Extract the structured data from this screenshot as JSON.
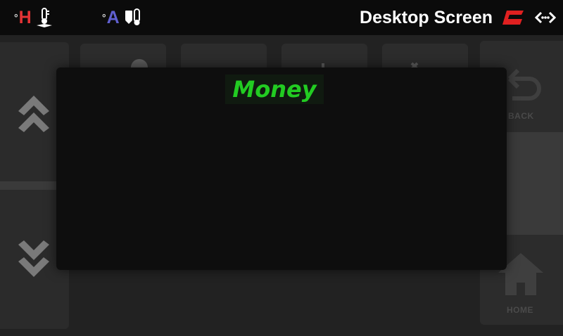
{
  "topbar": {
    "hot_temp": {
      "degree": "°",
      "letter": "H",
      "icon": "hotend-thermometer-icon"
    },
    "ambient_temp": {
      "degree": "°",
      "letter": "A",
      "icon": "ambient-thermometer-icon"
    },
    "screen_title": "Desktop Screen",
    "brand_icon": "brand-logo-icon",
    "connection_icon": "connection-arrows-icon"
  },
  "sidebar_left": {
    "scroll_up_icon": "double-chevron-up-icon",
    "scroll_down_icon": "double-chevron-down-icon"
  },
  "sidebar_right": {
    "back_label": "BACK",
    "home_label": "HOME"
  },
  "popup": {
    "title": "Money"
  },
  "colors": {
    "background": "#222222",
    "topbar": "#0b0b0b",
    "hot_accent": "#e43335",
    "ambient_accent": "#6060d0",
    "popup_bg": "#0e0e0e",
    "title_green": "#22cc22"
  }
}
